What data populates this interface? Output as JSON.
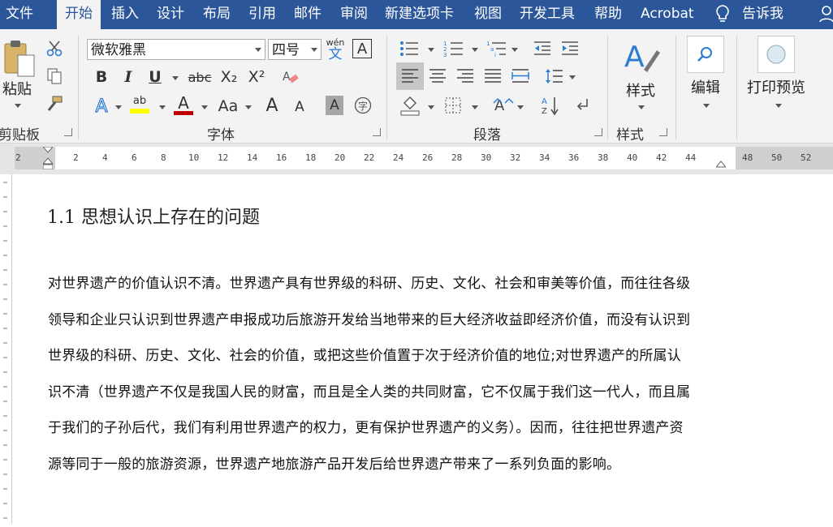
{
  "tabs": [
    {
      "label": "文件"
    },
    {
      "label": "开始"
    },
    {
      "label": "插入"
    },
    {
      "label": "设计"
    },
    {
      "label": "布局"
    },
    {
      "label": "引用"
    },
    {
      "label": "邮件"
    },
    {
      "label": "审阅"
    },
    {
      "label": "新建选项卡"
    },
    {
      "label": "视图"
    },
    {
      "label": "开发工具"
    },
    {
      "label": "帮助"
    },
    {
      "label": "Acrobat"
    },
    {
      "label": "告诉我"
    }
  ],
  "ribbon": {
    "clipboard": {
      "paste_label": "粘贴",
      "group_label": "剪贴板"
    },
    "font": {
      "font_name": "微软雅黑",
      "font_size": "四号",
      "phonetic_top": "wén",
      "phonetic_bottom": "文",
      "group_label": "字体",
      "bold": "B",
      "italic": "I",
      "underline": "U",
      "strike": "abc",
      "subscript": "X₂",
      "superscript": "X²",
      "case": "Aa",
      "grow": "A",
      "shrink": "A",
      "char_shade": "A"
    },
    "paragraph": {
      "group_label": "段落"
    },
    "styles": {
      "label": "样式",
      "group_label": "样式"
    },
    "editing": {
      "label": "编辑"
    },
    "print_preview": {
      "label": "打印预览"
    }
  },
  "ruler": {
    "ticks": [
      "2",
      "2",
      "4",
      "6",
      "8",
      "10",
      "12",
      "14",
      "16",
      "18",
      "20",
      "22",
      "24",
      "26",
      "28",
      "30",
      "32",
      "34",
      "36",
      "38",
      "40",
      "42",
      "44",
      "48",
      "50",
      "52"
    ]
  },
  "document": {
    "heading": "1.1  思想认识上存在的问题",
    "paragraph_lines": [
      "对世界遗产的价值认识不清。世界遗产具有世界级的科研、历史、文化、社会和审美等价值，而往往各级",
      "领导和企业只认识到世界遗产申报成功后旅游开发给当地带来的巨大经济收益即经济价值，而没有认识到",
      "世界级的科研、历史、文化、社会的价值，或把这些价值置于次于经济价值的地位;对世界遗产的所属认",
      "识不清（世界遗产不仅是我国人民的财富，而且是全人类的共同财富，它不仅属于我们这一代人，而且属",
      "于我们的子孙后代，我们有利用世界遗产的权力，更有保护世界遗产的义务）。因而，往往把世界遗产资",
      "源等同于一般的旅游资源，世界遗产地旅游产品开发后给世界遗产带来了一系列负面的影响。"
    ]
  },
  "colors": {
    "tab_bar": "#2b579a",
    "ribbon_bg": "#f3f3f3",
    "highlight": "#ffff00",
    "font_color": "#c00000",
    "icon_blue": "#2b7cd3"
  }
}
